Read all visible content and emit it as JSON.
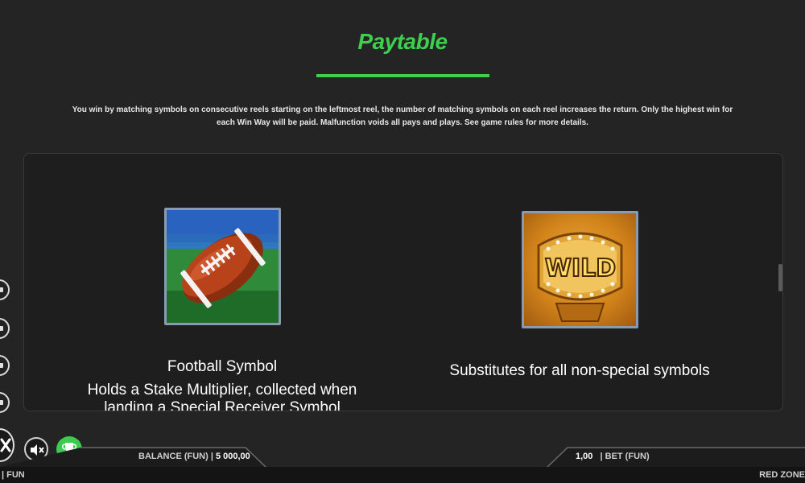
{
  "paytable": {
    "title": "Paytable",
    "intro": "You win by matching symbols on consecutive reels starting on the leftmost reel, the number of matching symbols on each reel increases the return. Only the highest win for each Win Way will be paid. Malfunction voids all pays and plays. See game rules for more details."
  },
  "symbols": [
    {
      "name": "Football Symbol",
      "description": "Holds a Stake Multiplier, collected when landing a Special Receiver Symbol",
      "icon": "football-icon"
    },
    {
      "name": "",
      "description": "Substitutes for all non-special symbols",
      "icon": "wild-ring-icon",
      "art_text": "WILD"
    }
  ],
  "bottom_bar": {
    "balance_label": "BALANCE (FUN)",
    "balance_value": "5 000,00",
    "bet_value": "1,00",
    "bet_label": "BET (FUN)",
    "footer_left": "| FUN",
    "footer_right": "RED ZONE"
  },
  "colors": {
    "accent": "#3ecf4f",
    "background": "#242424",
    "panel": "#1e1e1e"
  }
}
